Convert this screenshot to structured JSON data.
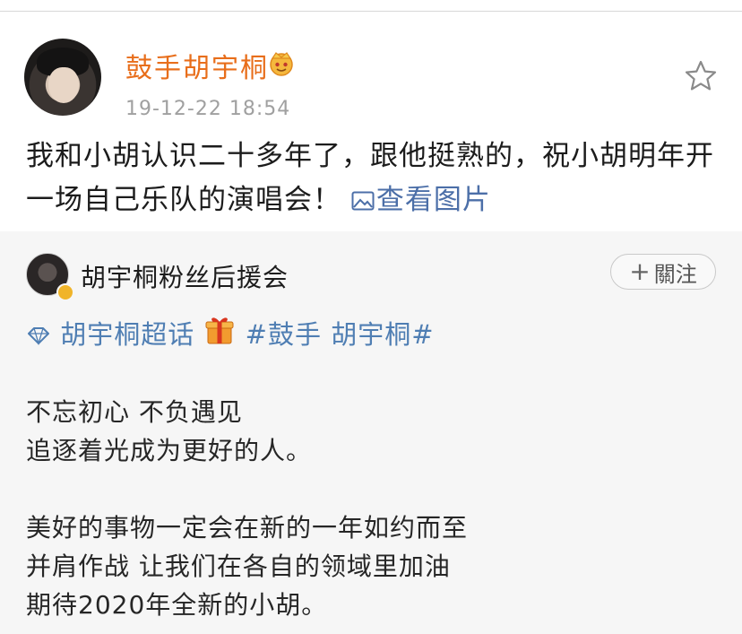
{
  "post": {
    "username": "鼓手胡宇桐",
    "timestamp": "19-12-22 18:54",
    "text": "我和小胡认识二十多年了，跟他挺熟的，祝小胡明年开一场自己乐队的演唱会！",
    "view_images_label": "查看图片",
    "icons": {
      "badge": "crown-icon",
      "favorite": "star-icon",
      "image": "image-icon"
    }
  },
  "repost": {
    "username": "胡宇桐粉丝后援会",
    "follow_label": "關注",
    "supertopic_label": "胡宇桐超话",
    "hashtag_label": "#鼓手 胡宇桐#",
    "lines": [
      "不忘初心 不负遇见",
      "追逐着光成为更好的人。",
      "",
      "美好的事物一定会在新的一年如约而至",
      "并肩作战 让我们在各自的领域里加油",
      "期待2020年全新的小胡。"
    ],
    "icons": {
      "supertopic": "diamond-icon",
      "gift": "gift-icon",
      "verified": "verified-badge-icon"
    }
  },
  "colors": {
    "username": "#e86e1b",
    "link": "#4c6fa8",
    "tag": "#4f7eb3",
    "timestamp": "#a0a0a0",
    "repost_background": "#f6f6f6"
  }
}
